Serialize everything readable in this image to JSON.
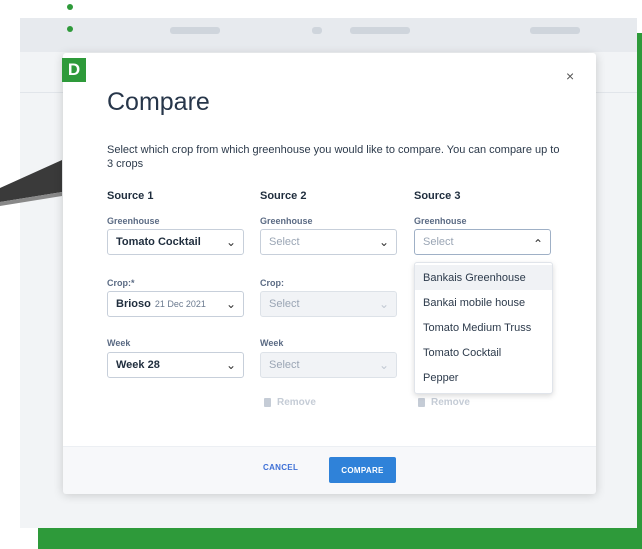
{
  "badge": "D",
  "modal": {
    "title": "Compare",
    "description": "Select which crop from which greenhouse you would like to compare. You can compare up to 3 crops",
    "close_icon": "×"
  },
  "sources": [
    {
      "heading": "Source 1",
      "greenhouse_label": "Greenhouse",
      "greenhouse_value": "Tomato Cocktail",
      "crop_label": "Crop:*",
      "crop_value": "Brioso",
      "crop_date": "21 Dec 2021",
      "week_label": "Week",
      "week_value": "Week 28"
    },
    {
      "heading": "Source 2",
      "greenhouse_label": "Greenhouse",
      "greenhouse_placeholder": "Select",
      "crop_label": "Crop:",
      "crop_placeholder": "Select",
      "week_label": "Week",
      "week_placeholder": "Select",
      "remove_label": "Remove"
    },
    {
      "heading": "Source 3",
      "greenhouse_label": "Greenhouse",
      "greenhouse_placeholder": "Select",
      "remove_label": "Remove"
    }
  ],
  "dropdown_options": [
    "Bankais Greenhouse",
    "Bankai mobile house",
    "Tomato Medium Truss",
    "Tomato Cocktail",
    "Pepper"
  ],
  "footer": {
    "cancel_label": "CANCEL",
    "compare_label": "COMPARE"
  },
  "icons": {
    "chevron_down": "⌄",
    "chevron_up": "⌃"
  },
  "colors": {
    "brand_green": "#2e9a3a",
    "primary_blue": "#2f82d9"
  }
}
